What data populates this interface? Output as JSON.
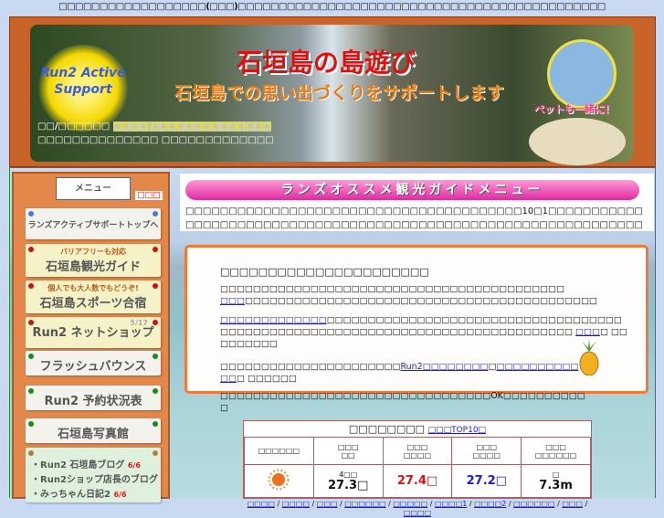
{
  "top_notice": "□□□□□□□□□□□□□□□□□□(□□□)□□□□□□□□□□□□□□□□□□□□□□□□□□□□□□□□□□□□□□□□□□□□□",
  "banner": {
    "logo_text": "Run2 Active Support",
    "title": "石垣島の島遊び",
    "subtitle": "石垣島での思い出づくりをサポートします",
    "pet_caption": "ペットも一緒に！",
    "info_label": "□□/□□□□□□",
    "info_highlight": "□□□□ □□□□□□□□□□□□□□",
    "info_line2": "□□□□□□□□□□□□□□ □□□□□□□□□□□□□"
  },
  "sidebar": {
    "menu_header": "メニュー",
    "new_badge": "□□□",
    "items": [
      {
        "label": "ランズアクティブサポートトップへ",
        "style": "w",
        "pin": "#4a7ad0"
      },
      {
        "sub": "バリアフリーも対応",
        "label": "石垣島観光ガイド",
        "style": "y",
        "pin": "#d01010"
      },
      {
        "sub": "個人でも大人数でもどうぞ!",
        "label": "石垣島スポーツ合宿",
        "style": "y",
        "pin": "#d01010"
      },
      {
        "date": "5/17",
        "label": "Run2 ネットショップ",
        "style": "y",
        "pin": "#d01010"
      },
      {
        "label": "フラッシュバウンス",
        "style": "w",
        "pin": "#1a8a1a"
      },
      {
        "label": "Run2 予約状況表",
        "style": "w",
        "pin": "#1a8a1a"
      },
      {
        "label": "石垣島写真館",
        "style": "w",
        "pin": "#1a8a1a"
      }
    ],
    "blogs": [
      {
        "label": "・Run2 石垣島ブログ",
        "date": "6/6"
      },
      {
        "label": "・Run2ショップ店長のブログ",
        "date": ""
      },
      {
        "label": "・みっちゃん日記2",
        "date": "6/6"
      }
    ]
  },
  "content": {
    "header": "ランズオススメ観光ガイドメニュー",
    "intro": "□□□□□□□□□□□□□□□□□□□□□□□□□□□□□□□□□□□□□□□10□1□□□□□□□□□□□□□□□□□□□□□□□□□□□□□□□□□□□□□□□□□□□□□□□□□□□□□□□□□□□□□□□□",
    "box": {
      "heading": "□□□□□□□□□□□□□□□□□□□□□□",
      "p1": "□□□□□□□□□□□□□□□□□□□□□□□□□□□□□□□□□□□□□□□□□□",
      "p1_link": "□□□",
      "p1_rest": "□□□□□□□□□□□□□□□□□□□□□□□□□□□□□□□□□□□□□□□□□□□",
      "p2_link": "□□□□□□□□□□□□□",
      "p2_rest": "□□□□□□□□□□□□□□□□□□□□□□□□□□□□□□□□□□□□□□□□□□□□□□□□□□□□□□□□□□□□□□□□□□□□□□□□□□□□□□□",
      "p2_link2": "□□□",
      "p2_tail": "□ □□□□□□□□□",
      "p3": "□□□□□□□□□□□□□□□□□□□□□□",
      "p3_link1": "Run2□□□□□□□□",
      "p3_mid": "□",
      "p3_link2": "□□□□□□□□□□□□",
      "p3_tail": "□ □□□□□□",
      "p4": "□□□□□□□□□□□□□□□□□□□□□□□□□□□□□□□□□OK□□□□□□□□□□□"
    }
  },
  "weather": {
    "title": "□□□□□□□□",
    "title_link": "□□□TOP10□",
    "headers": [
      "□□□□□□",
      "□□□\n□□",
      "□□□\n□□□□",
      "□□□\n□□□□",
      "□□□\n□□□□□□"
    ],
    "icon": "sun-icon",
    "temp_label": "4□□",
    "temp": "27.3□",
    "high": "27.4□",
    "low": "27.2□",
    "wind_dir": "□",
    "wind": "7.3m",
    "high_color": "#e01010",
    "low_color": "#1a1ae0",
    "links": [
      "□□□□",
      "□□□□",
      "□□□",
      "□□□□□□",
      "□□□□□",
      "□□□□1",
      "□□□□2",
      "□□□□□□",
      "□□□",
      "□□□□"
    ]
  }
}
